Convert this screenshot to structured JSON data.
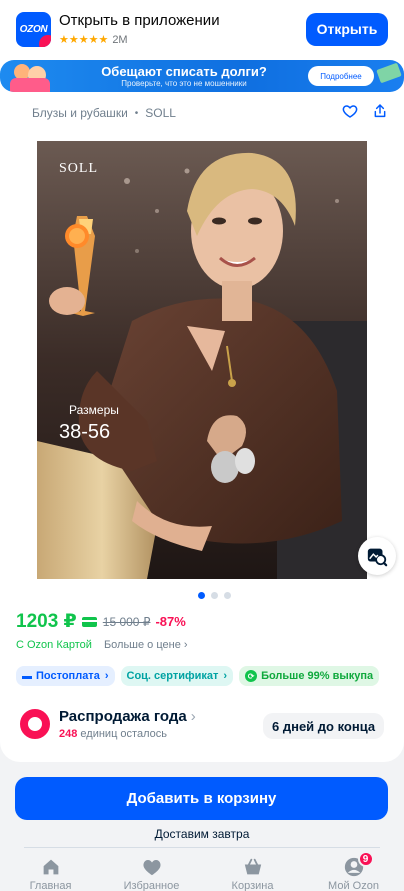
{
  "app_banner": {
    "logo_text": "OZON",
    "title": "Открыть в приложении",
    "stars": "★★★★★",
    "downloads": "2M",
    "open_label": "Открыть"
  },
  "promo": {
    "title": "Обещают списать долги?",
    "subtitle": "Проверьте, что это не мошенники",
    "button_label": "Подробнее"
  },
  "breadcrumbs": {
    "category": "Блузы и рубашки",
    "separator": "•",
    "brand": "SOLL"
  },
  "photo": {
    "brand": "SOLL",
    "sizes_label": "Размеры",
    "sizes_value": "38-56",
    "slides_total": 3,
    "slide_active": 1
  },
  "price": {
    "current": "1203 ₽",
    "old": "15 000 ₽",
    "discount": "-87%",
    "card_label": "С Ozon Картой",
    "more_label": "Больше о цене ›"
  },
  "tags": [
    {
      "label": "Постоплата",
      "chevron": "›"
    },
    {
      "label": "Соц. сертификат",
      "chevron": "›"
    },
    {
      "label": "Больше 99% выкупа",
      "chevron": ""
    }
  ],
  "sale": {
    "title": "Распродажа года",
    "chevron": "›",
    "count": "248",
    "count_suffix": " единиц осталось",
    "days_left": "6 дней до конца"
  },
  "cart": {
    "add_label": "Добавить в корзину",
    "delivery": "Доставим завтра"
  },
  "tabbar": {
    "items": [
      {
        "label": "Главная",
        "icon": "home-icon"
      },
      {
        "label": "Избранное",
        "icon": "heart-icon"
      },
      {
        "label": "Корзина",
        "icon": "basket-icon"
      },
      {
        "label": "Мой Ozon",
        "icon": "profile-icon",
        "badge": "9"
      }
    ]
  },
  "colors": {
    "brand_blue": "#005bff",
    "price_green": "#10c44c",
    "accent_pink": "#f91155"
  }
}
